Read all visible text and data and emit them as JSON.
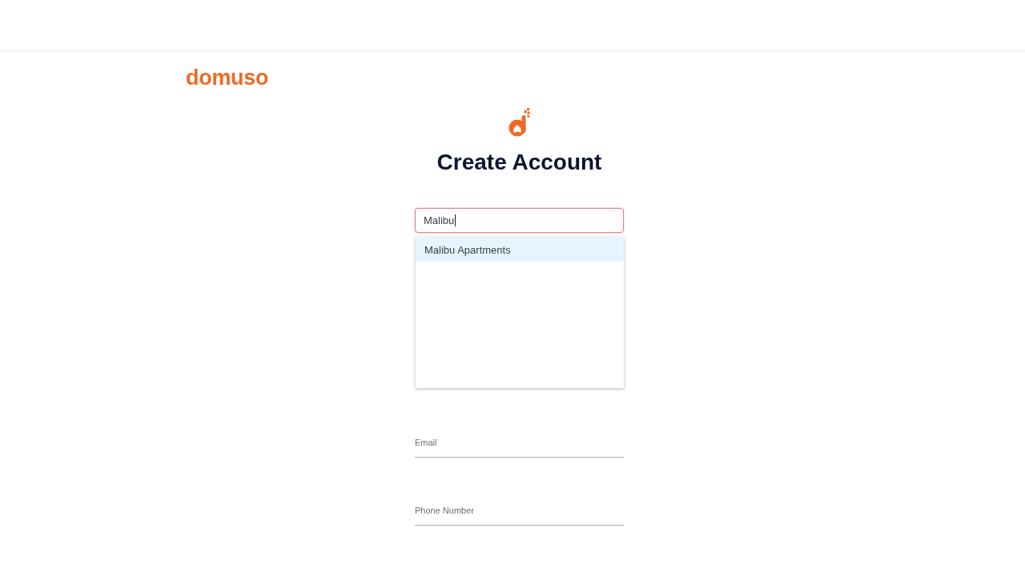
{
  "logo": {
    "text": "domuso"
  },
  "form": {
    "title": "Create Account",
    "search": {
      "value": "Malibu",
      "focused": true
    },
    "suggestions": [
      {
        "label": "Malibu Apartments",
        "selected": true
      }
    ],
    "fields": [
      {
        "placeholder": "Email"
      },
      {
        "placeholder": "Phone Number"
      }
    ]
  }
}
